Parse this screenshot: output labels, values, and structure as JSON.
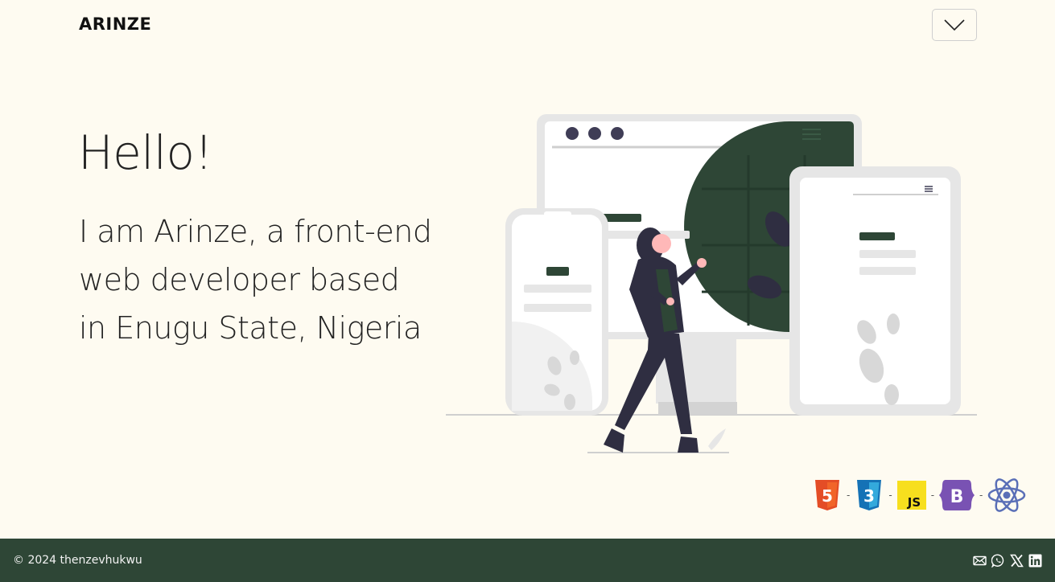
{
  "nav": {
    "logo": "ARINZE",
    "menu_toggle_icon": "chevron-down-icon"
  },
  "hero": {
    "greeting": "Hello!",
    "intro": "I am Arinze, a front-end web developer based in Enugu State, Nigeria",
    "illustration_icon": "web-devices-illustration"
  },
  "tech_stack": [
    {
      "name": "html5-icon",
      "color": "#e44d26"
    },
    {
      "name": "css3-icon",
      "color": "#1572b6"
    },
    {
      "name": "javascript-icon",
      "color": "#f7df1e"
    },
    {
      "name": "bootstrap-icon",
      "color": "#7952b3"
    },
    {
      "name": "react-icon",
      "color": "#5a6fb7"
    }
  ],
  "footer": {
    "copyright": "© 2024 thenzevhukwu",
    "social": [
      "mail-icon",
      "whatsapp-icon",
      "x-icon",
      "linkedin-icon"
    ]
  },
  "colors": {
    "background": "#fefbf1",
    "accent": "#2e4636",
    "text": "#222222"
  }
}
